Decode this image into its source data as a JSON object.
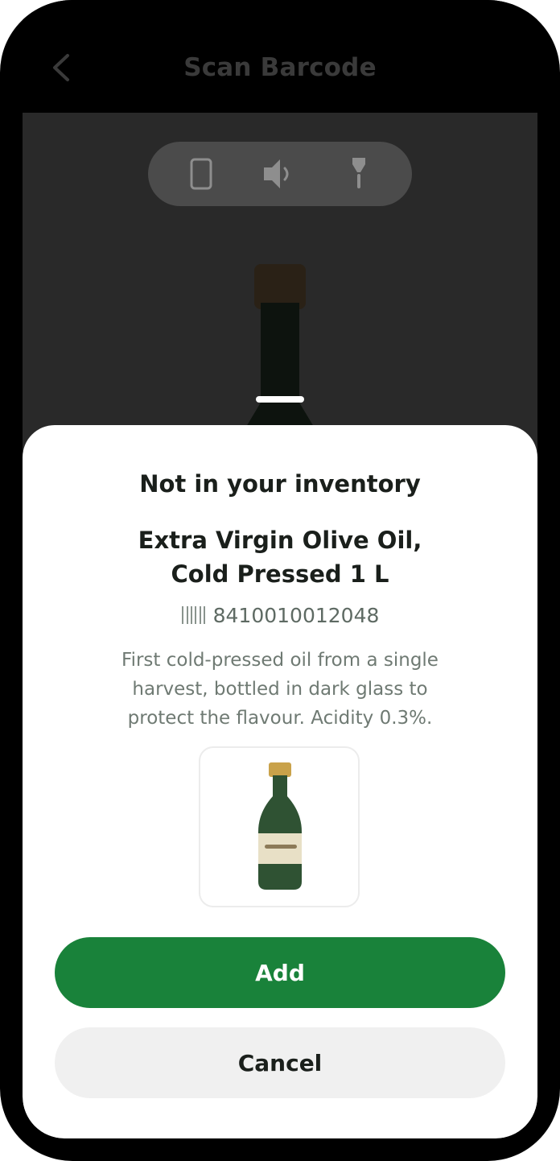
{
  "header": {
    "title": "Scan Barcode",
    "back_icon": "chevron-left-icon"
  },
  "camera_controls": [
    {
      "name": "flip-camera-icon"
    },
    {
      "name": "sound-icon"
    },
    {
      "name": "flashlight-icon"
    }
  ],
  "sheet": {
    "status": "Not in your inventory",
    "product_name_line1": "Extra Virgin Olive Oil,",
    "product_name_line2": "Cold Pressed 1 L",
    "barcode": "8410010012048",
    "description_line1": "First cold-pressed oil from a single",
    "description_line2": "harvest, bottled in dark glass to",
    "description_line3": "protect the flavour. Acidity 0.3%.",
    "add_label": "Add",
    "cancel_label": "Cancel"
  },
  "colors": {
    "accent": "#19823a",
    "background": "#000000",
    "sheet": "#ffffff",
    "bottle_green": "#2f5233",
    "bottle_cap": "#c9a24a"
  }
}
